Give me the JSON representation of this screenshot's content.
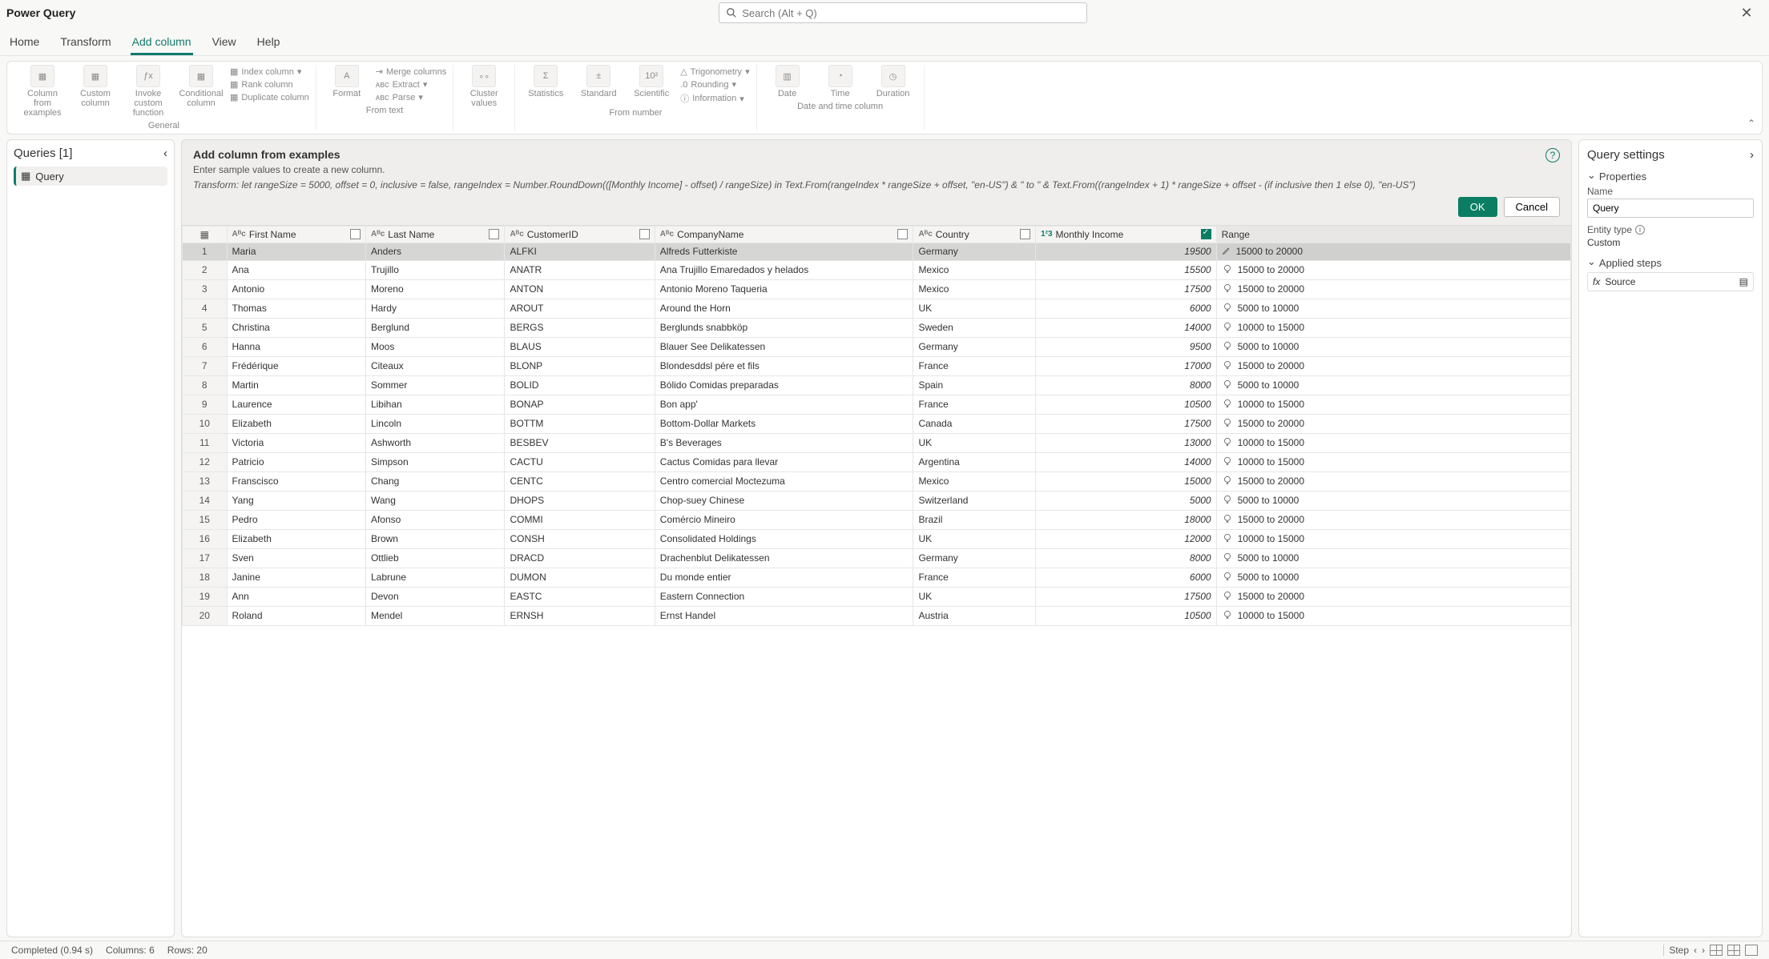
{
  "app_title": "Power Query",
  "search_placeholder": "Search (Alt + Q)",
  "tabs": {
    "home": "Home",
    "transform": "Transform",
    "add_column": "Add column",
    "view": "View",
    "help": "Help"
  },
  "ribbon": {
    "general": {
      "label": "General",
      "column_from_examples": "Column from examples",
      "custom_column": "Custom column",
      "invoke_custom_function": "Invoke custom function",
      "conditional_column": "Conditional column",
      "index_column": "Index column",
      "rank_column": "Rank column",
      "duplicate_column": "Duplicate column"
    },
    "from_text": {
      "label": "From text",
      "format": "Format",
      "merge_columns": "Merge columns",
      "extract": "Extract",
      "parse": "Parse"
    },
    "cluster": {
      "cluster_values": "Cluster values"
    },
    "from_number": {
      "label": "From number",
      "statistics": "Statistics",
      "standard": "Standard",
      "scientific": "Scientific",
      "trigonometry": "Trigonometry",
      "rounding": "Rounding",
      "information": "Information"
    },
    "date_time": {
      "label": "Date and time column",
      "date": "Date",
      "time": "Time",
      "duration": "Duration"
    }
  },
  "queries": {
    "header": "Queries [1]",
    "item": "Query"
  },
  "banner": {
    "title": "Add column from examples",
    "subtitle": "Enter sample values to create a new column.",
    "formula": "Transform: let rangeSize = 5000, offset = 0, inclusive = false, rangeIndex = Number.RoundDown(([Monthly Income] - offset) / rangeSize) in Text.From(rangeIndex * rangeSize + offset, \"en-US\") & \" to \" & Text.From((rangeIndex + 1) * rangeSize + offset - (if inclusive then 1 else 0), \"en-US\")",
    "ok": "OK",
    "cancel": "Cancel"
  },
  "columns": {
    "first_name": "First Name",
    "last_name": "Last Name",
    "customer_id": "CustomerID",
    "company_name": "CompanyName",
    "country": "Country",
    "monthly_income": "Monthly Income",
    "range": "Range"
  },
  "rows": [
    {
      "n": "1",
      "fn": "Maria",
      "ln": "Anders",
      "id": "ALFKI",
      "co": "Alfreds Futterkiste",
      "ct": "Germany",
      "mi": "19500",
      "rg": "15000 to 20000",
      "sel": true
    },
    {
      "n": "2",
      "fn": "Ana",
      "ln": "Trujillo",
      "id": "ANATR",
      "co": "Ana Trujillo Emaredados y helados",
      "ct": "Mexico",
      "mi": "15500",
      "rg": "15000 to 20000"
    },
    {
      "n": "3",
      "fn": "Antonio",
      "ln": "Moreno",
      "id": "ANTON",
      "co": "Antonio Moreno Taqueria",
      "ct": "Mexico",
      "mi": "17500",
      "rg": "15000 to 20000"
    },
    {
      "n": "4",
      "fn": "Thomas",
      "ln": "Hardy",
      "id": "AROUT",
      "co": "Around the Horn",
      "ct": "UK",
      "mi": "6000",
      "rg": "5000 to 10000"
    },
    {
      "n": "5",
      "fn": "Christina",
      "ln": "Berglund",
      "id": "BERGS",
      "co": "Berglunds snabbköp",
      "ct": "Sweden",
      "mi": "14000",
      "rg": "10000 to 15000"
    },
    {
      "n": "6",
      "fn": "Hanna",
      "ln": "Moos",
      "id": "BLAUS",
      "co": "Blauer See Delikatessen",
      "ct": "Germany",
      "mi": "9500",
      "rg": "5000 to 10000"
    },
    {
      "n": "7",
      "fn": "Frédérique",
      "ln": "Citeaux",
      "id": "BLONP",
      "co": "Blondesddsl pére et fils",
      "ct": "France",
      "mi": "17000",
      "rg": "15000 to 20000"
    },
    {
      "n": "8",
      "fn": "Martin",
      "ln": "Sommer",
      "id": "BOLID",
      "co": "Bólido Comidas preparadas",
      "ct": "Spain",
      "mi": "8000",
      "rg": "5000 to 10000"
    },
    {
      "n": "9",
      "fn": "Laurence",
      "ln": "Libihan",
      "id": "BONAP",
      "co": "Bon app'",
      "ct": "France",
      "mi": "10500",
      "rg": "10000 to 15000"
    },
    {
      "n": "10",
      "fn": "Elizabeth",
      "ln": "Lincoln",
      "id": "BOTTM",
      "co": "Bottom-Dollar Markets",
      "ct": "Canada",
      "mi": "17500",
      "rg": "15000 to 20000"
    },
    {
      "n": "11",
      "fn": "Victoria",
      "ln": "Ashworth",
      "id": "BESBEV",
      "co": "B's Beverages",
      "ct": "UK",
      "mi": "13000",
      "rg": "10000 to 15000"
    },
    {
      "n": "12",
      "fn": "Patricio",
      "ln": "Simpson",
      "id": "CACTU",
      "co": "Cactus Comidas para llevar",
      "ct": "Argentina",
      "mi": "14000",
      "rg": "10000 to 15000"
    },
    {
      "n": "13",
      "fn": "Franscisco",
      "ln": "Chang",
      "id": "CENTC",
      "co": "Centro comercial Moctezuma",
      "ct": "Mexico",
      "mi": "15000",
      "rg": "15000 to 20000"
    },
    {
      "n": "14",
      "fn": "Yang",
      "ln": "Wang",
      "id": "DHOPS",
      "co": "Chop-suey Chinese",
      "ct": "Switzerland",
      "mi": "5000",
      "rg": "5000 to 10000"
    },
    {
      "n": "15",
      "fn": "Pedro",
      "ln": "Afonso",
      "id": "COMMI",
      "co": "Comércio Mineiro",
      "ct": "Brazil",
      "mi": "18000",
      "rg": "15000 to 20000"
    },
    {
      "n": "16",
      "fn": "Elizabeth",
      "ln": "Brown",
      "id": "CONSH",
      "co": "Consolidated Holdings",
      "ct": "UK",
      "mi": "12000",
      "rg": "10000 to 15000"
    },
    {
      "n": "17",
      "fn": "Sven",
      "ln": "Ottlieb",
      "id": "DRACD",
      "co": "Drachenblut Delikatessen",
      "ct": "Germany",
      "mi": "8000",
      "rg": "5000 to 10000"
    },
    {
      "n": "18",
      "fn": "Janine",
      "ln": "Labrune",
      "id": "DUMON",
      "co": "Du monde entier",
      "ct": "France",
      "mi": "6000",
      "rg": "5000 to 10000"
    },
    {
      "n": "19",
      "fn": "Ann",
      "ln": "Devon",
      "id": "EASTC",
      "co": "Eastern Connection",
      "ct": "UK",
      "mi": "17500",
      "rg": "15000 to 20000"
    },
    {
      "n": "20",
      "fn": "Roland",
      "ln": "Mendel",
      "id": "ERNSH",
      "co": "Ernst Handel",
      "ct": "Austria",
      "mi": "10500",
      "rg": "10000 to 15000"
    }
  ],
  "settings": {
    "title": "Query settings",
    "properties": "Properties",
    "name_label": "Name",
    "name_value": "Query",
    "entity_type_label": "Entity type",
    "entity_type_value": "Custom",
    "applied_steps": "Applied steps",
    "step_source": "Source"
  },
  "status": {
    "completed": "Completed (0.94 s)",
    "columns": "Columns: 6",
    "rows": "Rows: 20",
    "step": "Step"
  }
}
